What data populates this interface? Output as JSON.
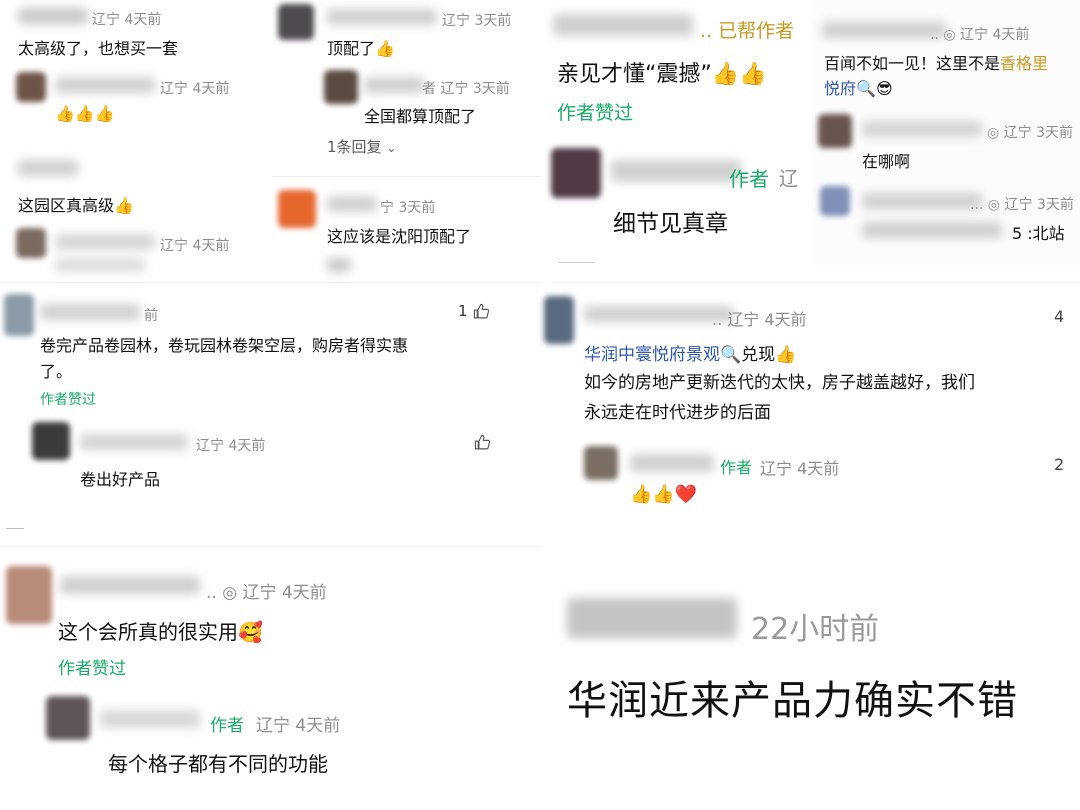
{
  "panels": {
    "p1": {
      "c1": {
        "meta": "辽宁 4天前",
        "text": "太高级了，也想买一套"
      },
      "c1_reply": {
        "meta": "辽宁 4天前",
        "emoji": "👍👍👍"
      },
      "c2": {
        "text": "这园区真高级👍"
      },
      "c2_reply": {
        "meta": "辽宁 4天前"
      }
    },
    "p2": {
      "c1": {
        "meta": "辽宁 3天前",
        "text": "顶配了👍"
      },
      "c1_reply": {
        "meta": "者 辽宁 3天前",
        "text": "全国都算顶配了"
      },
      "more": "1条回复",
      "c2": {
        "meta": "宁 3天前",
        "text": "这应该是沈阳顶配了"
      }
    },
    "p3": {
      "c1": {
        "tag": "前",
        "likes": "1",
        "text1": "卷完产品卷园林，卷玩园林卷架空层，购房者得实惠",
        "text2": "了。",
        "author_liked": "作者赞过"
      },
      "c1_reply": {
        "meta": "辽宁 4天前",
        "text": "卷出好产品"
      }
    },
    "p4": {
      "meta": ".. ◎ 辽宁 4天前",
      "text": "这个会所真的很实用🥰",
      "author_liked": "作者赞过",
      "reply": {
        "author": "作者",
        "meta": "辽宁 4天前",
        "text": "每个格子都有不同的功能"
      }
    },
    "p5": {
      "tag": ".. 已帮作者",
      "text": "亲见才懂“震撼”👍👍",
      "author_liked": "作者赞过",
      "reply": {
        "author": "作者",
        "meta": "辽",
        "text": "细节见真章"
      }
    },
    "p6": {
      "meta1": ".. ◎ 辽宁 4天前",
      "text1a": "百闻不如一见！这里不是",
      "text1b": "香格里",
      "text1c": "悦府",
      "text1d": "🔍😎",
      "r1": {
        "meta": "◎ 辽宁 3天前",
        "text": "在哪啊"
      },
      "r2": {
        "meta": "... ◎ 辽宁 3天前",
        "text": "5 :北站"
      }
    },
    "p7": {
      "meta": ".. 辽宁 4天前",
      "likes": "4",
      "link": "华润中寰悦府景观",
      "after_link": "🔍兑现👍",
      "text1": "如今的房地产更新迭代的太快，房子越盖越好，我们",
      "text2": "永远走在时代进步的后面",
      "reply": {
        "author": "作者",
        "meta": "辽宁 4天前",
        "likes": "2",
        "emoji": "👍👍❤️"
      }
    },
    "p8": {
      "meta": "22小时前",
      "text": "华润近来产品力确实不错"
    }
  },
  "colors": {
    "green": "#1aad6a",
    "meta_gray": "#8d8d8d",
    "link_blue": "#2f5aa8",
    "gold_icon": "#c9a227"
  },
  "icons": [
    "like-icon",
    "chevron-down-icon",
    "search-icon",
    "gold-badge-icon"
  ]
}
